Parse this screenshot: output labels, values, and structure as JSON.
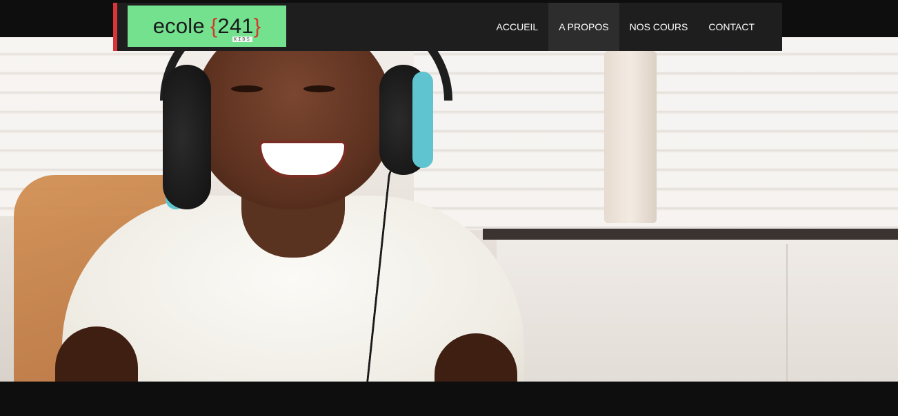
{
  "header": {
    "logo_text": "ecole",
    "logo_open_brace": "{",
    "logo_number": "241",
    "logo_close_brace": "}",
    "logo_sub": "KIDS"
  },
  "nav": {
    "items": [
      {
        "label": "ACCUEIL",
        "active": false
      },
      {
        "label": "A PROPOS",
        "active": true
      },
      {
        "label": "NOS COURS",
        "active": false
      },
      {
        "label": "CONTACT",
        "active": false
      }
    ]
  },
  "colors": {
    "navbar_bg": "#1e1e1e",
    "navbar_accent": "#d8343a",
    "logo_bg": "#74e18f",
    "page_bg": "#0e0e0e"
  },
  "hero": {
    "icon": "child-with-headphones-photo"
  }
}
